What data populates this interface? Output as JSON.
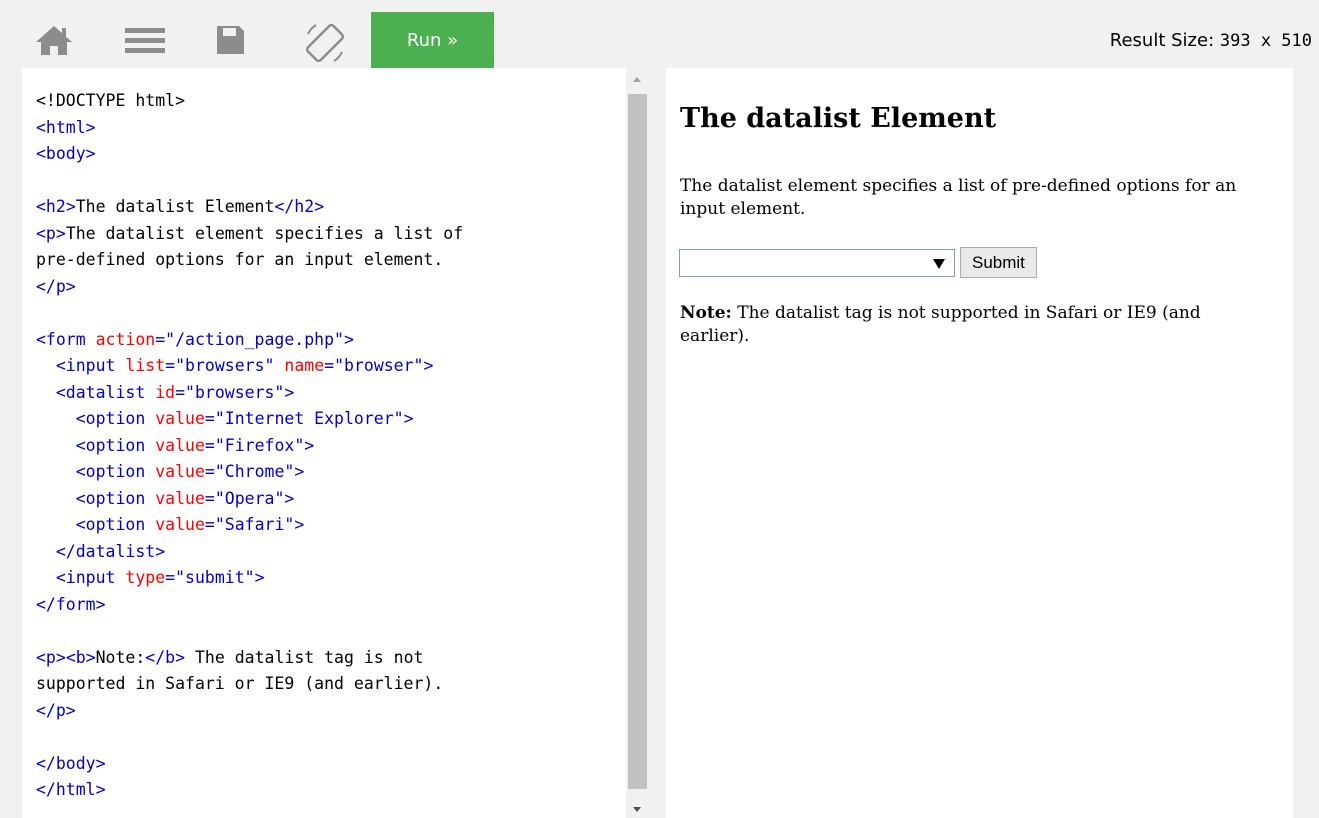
{
  "toolbar": {
    "icons": {
      "home": "home-icon",
      "menu": "menu-icon",
      "save": "save-icon",
      "rotate": "rotate-icon"
    },
    "run_label": "Run »",
    "result_size_label": "Result Size:",
    "result_size_value": "393 x 510"
  },
  "colors": {
    "run_button": "#4caf50",
    "tag": "#0000cd",
    "attribute": "#ff0000",
    "value": "#0000cd"
  },
  "code": {
    "lines": [
      "<!DOCTYPE html>",
      "<html>",
      "<body>",
      "",
      "<h2>The datalist Element</h2>",
      "<p>The datalist element specifies a list of",
      "pre-defined options for an input element.",
      "</p>",
      "",
      "<form action=\"/action_page.php\">",
      "  <input list=\"browsers\" name=\"browser\">",
      "  <datalist id=\"browsers\">",
      "    <option value=\"Internet Explorer\">",
      "    <option value=\"Firefox\">",
      "    <option value=\"Chrome\">",
      "    <option value=\"Opera\">",
      "    <option value=\"Safari\">",
      "  </datalist>",
      "  <input type=\"submit\">",
      "</form>",
      "",
      "<p><b>Note:</b> The datalist tag is not",
      "supported in Safari or IE9 (and earlier).",
      "</p>",
      "",
      "</body>",
      "</html>"
    ]
  },
  "result": {
    "heading": "The datalist Element",
    "paragraph": "The datalist element specifies a list of pre-defined options for an input element.",
    "input_value": "",
    "submit_label": "Submit",
    "note_bold": "Note:",
    "note_text": " The datalist tag is not supported in Safari or IE9 (and earlier)."
  }
}
